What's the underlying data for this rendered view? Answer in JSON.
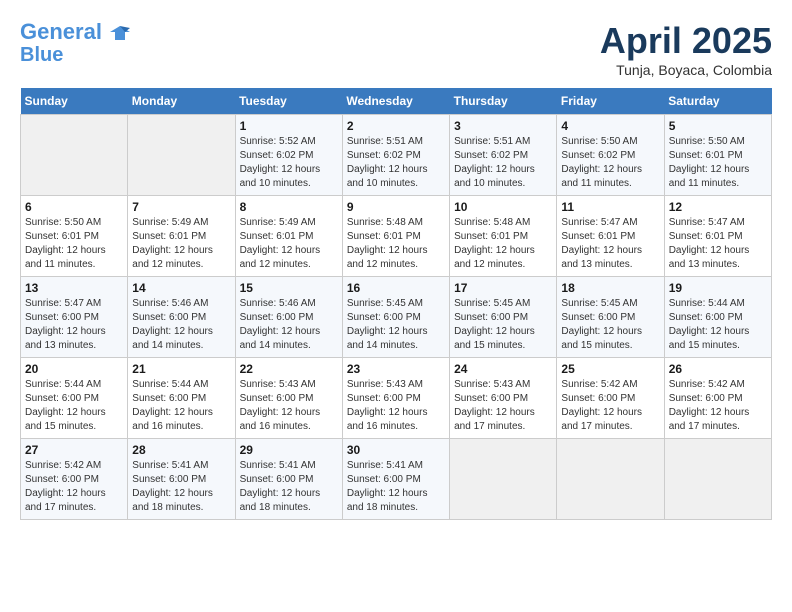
{
  "header": {
    "logo_line1": "General",
    "logo_line2": "Blue",
    "month_title": "April 2025",
    "subtitle": "Tunja, Boyaca, Colombia"
  },
  "weekdays": [
    "Sunday",
    "Monday",
    "Tuesday",
    "Wednesday",
    "Thursday",
    "Friday",
    "Saturday"
  ],
  "weeks": [
    [
      {
        "day": "",
        "content": ""
      },
      {
        "day": "",
        "content": ""
      },
      {
        "day": "1",
        "content": "Sunrise: 5:52 AM\nSunset: 6:02 PM\nDaylight: 12 hours and 10 minutes."
      },
      {
        "day": "2",
        "content": "Sunrise: 5:51 AM\nSunset: 6:02 PM\nDaylight: 12 hours and 10 minutes."
      },
      {
        "day": "3",
        "content": "Sunrise: 5:51 AM\nSunset: 6:02 PM\nDaylight: 12 hours and 10 minutes."
      },
      {
        "day": "4",
        "content": "Sunrise: 5:50 AM\nSunset: 6:02 PM\nDaylight: 12 hours and 11 minutes."
      },
      {
        "day": "5",
        "content": "Sunrise: 5:50 AM\nSunset: 6:01 PM\nDaylight: 12 hours and 11 minutes."
      }
    ],
    [
      {
        "day": "6",
        "content": "Sunrise: 5:50 AM\nSunset: 6:01 PM\nDaylight: 12 hours and 11 minutes."
      },
      {
        "day": "7",
        "content": "Sunrise: 5:49 AM\nSunset: 6:01 PM\nDaylight: 12 hours and 12 minutes."
      },
      {
        "day": "8",
        "content": "Sunrise: 5:49 AM\nSunset: 6:01 PM\nDaylight: 12 hours and 12 minutes."
      },
      {
        "day": "9",
        "content": "Sunrise: 5:48 AM\nSunset: 6:01 PM\nDaylight: 12 hours and 12 minutes."
      },
      {
        "day": "10",
        "content": "Sunrise: 5:48 AM\nSunset: 6:01 PM\nDaylight: 12 hours and 12 minutes."
      },
      {
        "day": "11",
        "content": "Sunrise: 5:47 AM\nSunset: 6:01 PM\nDaylight: 12 hours and 13 minutes."
      },
      {
        "day": "12",
        "content": "Sunrise: 5:47 AM\nSunset: 6:01 PM\nDaylight: 12 hours and 13 minutes."
      }
    ],
    [
      {
        "day": "13",
        "content": "Sunrise: 5:47 AM\nSunset: 6:00 PM\nDaylight: 12 hours and 13 minutes."
      },
      {
        "day": "14",
        "content": "Sunrise: 5:46 AM\nSunset: 6:00 PM\nDaylight: 12 hours and 14 minutes."
      },
      {
        "day": "15",
        "content": "Sunrise: 5:46 AM\nSunset: 6:00 PM\nDaylight: 12 hours and 14 minutes."
      },
      {
        "day": "16",
        "content": "Sunrise: 5:45 AM\nSunset: 6:00 PM\nDaylight: 12 hours and 14 minutes."
      },
      {
        "day": "17",
        "content": "Sunrise: 5:45 AM\nSunset: 6:00 PM\nDaylight: 12 hours and 15 minutes."
      },
      {
        "day": "18",
        "content": "Sunrise: 5:45 AM\nSunset: 6:00 PM\nDaylight: 12 hours and 15 minutes."
      },
      {
        "day": "19",
        "content": "Sunrise: 5:44 AM\nSunset: 6:00 PM\nDaylight: 12 hours and 15 minutes."
      }
    ],
    [
      {
        "day": "20",
        "content": "Sunrise: 5:44 AM\nSunset: 6:00 PM\nDaylight: 12 hours and 15 minutes."
      },
      {
        "day": "21",
        "content": "Sunrise: 5:44 AM\nSunset: 6:00 PM\nDaylight: 12 hours and 16 minutes."
      },
      {
        "day": "22",
        "content": "Sunrise: 5:43 AM\nSunset: 6:00 PM\nDaylight: 12 hours and 16 minutes."
      },
      {
        "day": "23",
        "content": "Sunrise: 5:43 AM\nSunset: 6:00 PM\nDaylight: 12 hours and 16 minutes."
      },
      {
        "day": "24",
        "content": "Sunrise: 5:43 AM\nSunset: 6:00 PM\nDaylight: 12 hours and 17 minutes."
      },
      {
        "day": "25",
        "content": "Sunrise: 5:42 AM\nSunset: 6:00 PM\nDaylight: 12 hours and 17 minutes."
      },
      {
        "day": "26",
        "content": "Sunrise: 5:42 AM\nSunset: 6:00 PM\nDaylight: 12 hours and 17 minutes."
      }
    ],
    [
      {
        "day": "27",
        "content": "Sunrise: 5:42 AM\nSunset: 6:00 PM\nDaylight: 12 hours and 17 minutes."
      },
      {
        "day": "28",
        "content": "Sunrise: 5:41 AM\nSunset: 6:00 PM\nDaylight: 12 hours and 18 minutes."
      },
      {
        "day": "29",
        "content": "Sunrise: 5:41 AM\nSunset: 6:00 PM\nDaylight: 12 hours and 18 minutes."
      },
      {
        "day": "30",
        "content": "Sunrise: 5:41 AM\nSunset: 6:00 PM\nDaylight: 12 hours and 18 minutes."
      },
      {
        "day": "",
        "content": ""
      },
      {
        "day": "",
        "content": ""
      },
      {
        "day": "",
        "content": ""
      }
    ]
  ]
}
